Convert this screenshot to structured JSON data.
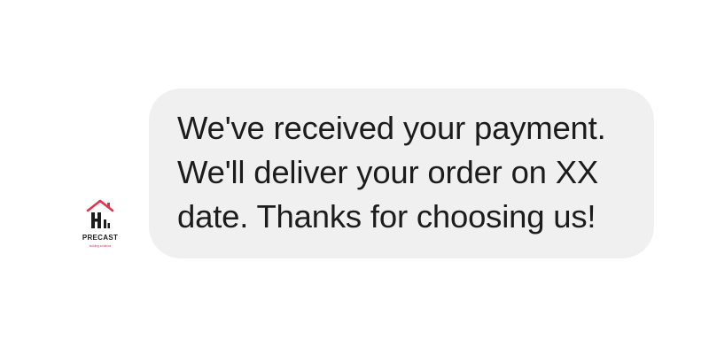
{
  "chat": {
    "sender": {
      "avatar_icon": "precast-logo-icon",
      "logo_wordmark": "PRECAST",
      "logo_tagline": "building solutions",
      "brand_color": "#e0344a"
    },
    "message": {
      "text": "We've received your payment.\nWe'll deliver your order on XX\ndate. Thanks for choosing us!",
      "bubble_color": "#f0f0f0",
      "text_color": "#1c1c1c"
    }
  }
}
